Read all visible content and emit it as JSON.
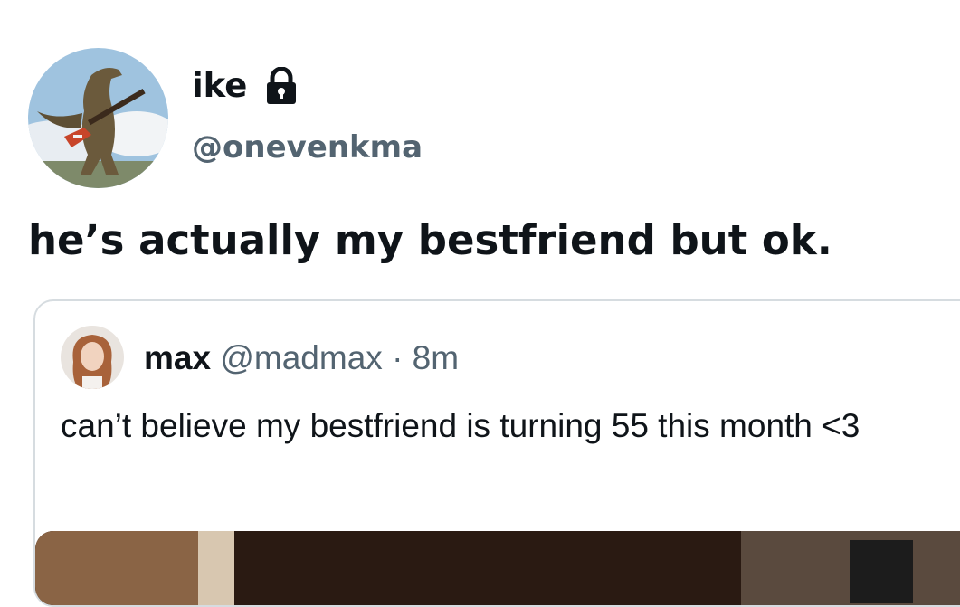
{
  "author": {
    "display_name": "ike",
    "handle": "@onevenkma",
    "avatar_icon": "dinosaur-guitar-avatar",
    "protected_icon": "lock-icon"
  },
  "tweet": {
    "text": "he’s actually my bestfriend but ok."
  },
  "quoted_tweet": {
    "display_name": "max",
    "handle": "@madmax",
    "separator": "·",
    "time": "8m",
    "text": "can’t believe my bestfriend is turning 55 this month <3",
    "avatar_icon": "user-photo-avatar"
  },
  "colors": {
    "text_primary": "#0f1419",
    "text_secondary": "#536471",
    "border": "#d6dce0"
  }
}
